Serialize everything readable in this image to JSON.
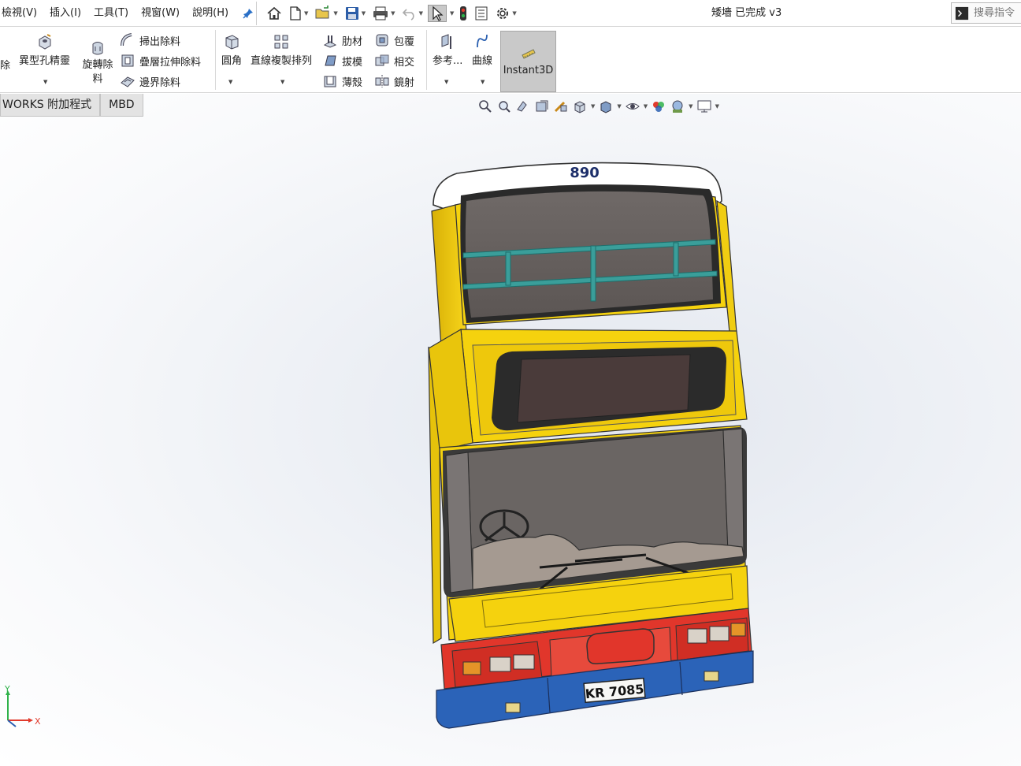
{
  "menu": {
    "items": [
      "檢視(V)",
      "插入(I)",
      "工具(T)",
      "視窗(W)",
      "說明(H)"
    ]
  },
  "window": {
    "title": "矮墻 已完成 v3"
  },
  "search": {
    "placeholder": "搜尋指令"
  },
  "ribbon": {
    "cut_partial": "除",
    "hole_wizard": "異型孔精靈",
    "revolve_cut": "旋轉除料",
    "swept_cut": "掃出除料",
    "lofted_cut": "疊層拉伸除料",
    "boundary_cut": "邊界除料",
    "fillet": "圓角",
    "linear_pattern": "直線複製排列",
    "rib": "肋材",
    "wrap": "包覆",
    "draft": "拔模",
    "intersect": "相交",
    "shell": "薄殼",
    "mirror": "鏡射",
    "reference": "参考...",
    "curves": "曲線",
    "instant3d": "Instant3D"
  },
  "tabs": [
    "WORKS 附加程式",
    "MBD"
  ],
  "model": {
    "route_number": "890",
    "license_plate": "KR 7085"
  },
  "triad": {
    "y_label": "Y",
    "x_label": "X"
  },
  "colors": {
    "bus_yellow": "#f5d20e",
    "bus_red": "#e1362b",
    "bus_blue": "#2b63b8",
    "window_grey": "#6b6462",
    "grille_teal": "#3a9e9a",
    "ui_active": "#c9c9c9"
  }
}
